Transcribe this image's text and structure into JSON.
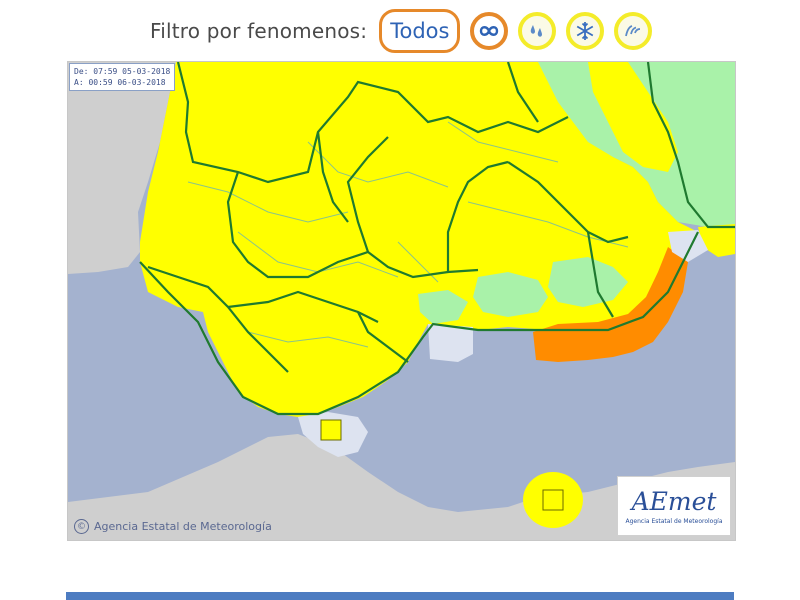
{
  "filter": {
    "label": "Filtro por fenomenos:",
    "all_label": "Todos",
    "buttons": [
      {
        "name": "wind-fenomeno-button",
        "icon": "wind-icon",
        "selected": true
      },
      {
        "name": "rain-fenomeno-button",
        "icon": "rain-drops-icon",
        "selected": false
      },
      {
        "name": "snow-fenomeno-button",
        "icon": "snowflake-icon",
        "selected": false
      },
      {
        "name": "coastal-fenomeno-button",
        "icon": "coastal-waves-icon",
        "selected": false
      }
    ]
  },
  "map": {
    "validity": {
      "from": "De:  07:59  05-03-2018",
      "to": "A:   00:59  06-03-2018"
    },
    "credit": "Agencia Estatal de Meteorología",
    "credit_mark": "©",
    "logo": {
      "wordmark_a": "A",
      "wordmark_rest": "Emet",
      "subtitle": "Agencia Estatal de Meteorología"
    },
    "colors": {
      "sea": "#a4b2cf",
      "land_outside": "#cfcfcf",
      "sea_zone": "#dde3f0",
      "yellow_warning": "#ffff00",
      "orange_warning": "#ff8c00",
      "green_no_warning": "#a9f2a9",
      "province_border": "#1f7a2f",
      "zone_border": "#8ac48a"
    }
  }
}
